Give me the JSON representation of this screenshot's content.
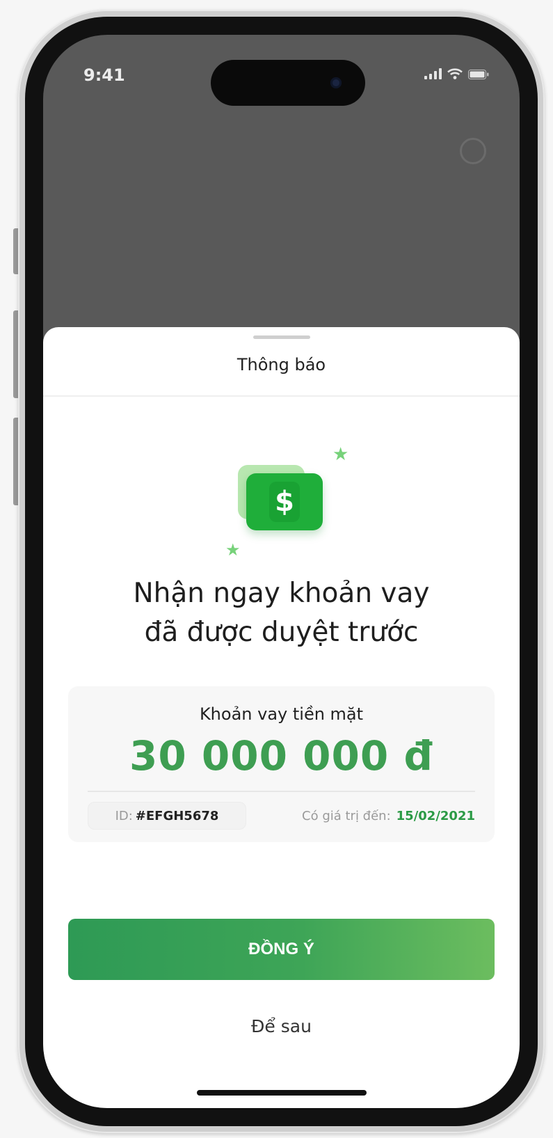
{
  "status_bar": {
    "time": "9:41"
  },
  "sheet": {
    "title": "Thông báo"
  },
  "headline": {
    "line1": "Nhận ngay khoản vay",
    "line2": "đã được duyệt trước"
  },
  "offer": {
    "label": "Khoản vay tiền mặt",
    "amount": "30 000 000 đ",
    "id_label": "ID:",
    "id_value": "#EFGH5678",
    "validity_label": "Có giá trị đến:",
    "validity_date": "15/02/2021"
  },
  "actions": {
    "agree_label": "ĐỒNG Ý",
    "later_label": "Để sau"
  },
  "icons": {
    "money": "money-bill-icon",
    "sparkle": "sparkle-icon",
    "info": "info-circle-icon"
  },
  "colors": {
    "accent": "#3e9e52",
    "button_gradient_start": "#2e9a55",
    "button_gradient_end": "#6cbd5f"
  }
}
